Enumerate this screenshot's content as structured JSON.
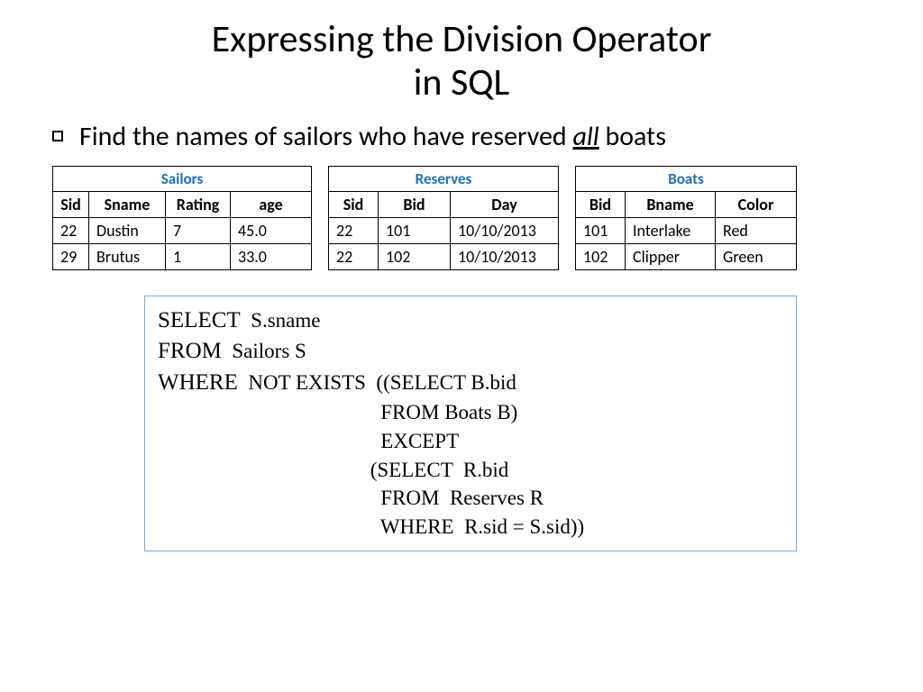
{
  "title": "Expressing the Division Operator\nin SQL",
  "bullet": {
    "pre": "Find the names of sailors who have reserved ",
    "em": "all",
    "post": " boats"
  },
  "tables": {
    "sailors": {
      "caption": "Sailors",
      "headers": [
        "Sid",
        "Sname",
        "Rating",
        "age"
      ],
      "rows": [
        [
          "22",
          "Dustin",
          "7",
          "45.0"
        ],
        [
          "29",
          "Brutus",
          "1",
          "33.0"
        ]
      ]
    },
    "reserves": {
      "caption": "Reserves",
      "headers": [
        "Sid",
        "Bid",
        "Day"
      ],
      "rows": [
        [
          "22",
          "101",
          "10/10/2013"
        ],
        [
          "22",
          "102",
          "10/10/2013"
        ]
      ]
    },
    "boats": {
      "caption": "Boats",
      "headers": [
        "Bid",
        "Bname",
        "Color"
      ],
      "rows": [
        [
          "101",
          "Interlake",
          "Red"
        ],
        [
          "102",
          "Clipper",
          "Green"
        ]
      ]
    }
  },
  "sql": {
    "kw_select": "SELECT",
    "a1": "  S.sname",
    "kw_from": "FROM",
    "a2": "  Sailors S",
    "kw_where": "WHERE",
    "a3": "  NOT EXISTS  ((SELECT B.bid",
    "l4": "                                           FROM Boats B)",
    "l5": "                                           EXCEPT",
    "l6": "                                         (SELECT  R.bid",
    "l7": "                                           FROM  Reserves R",
    "l8": "                                           WHERE  R.sid = S.sid))"
  }
}
